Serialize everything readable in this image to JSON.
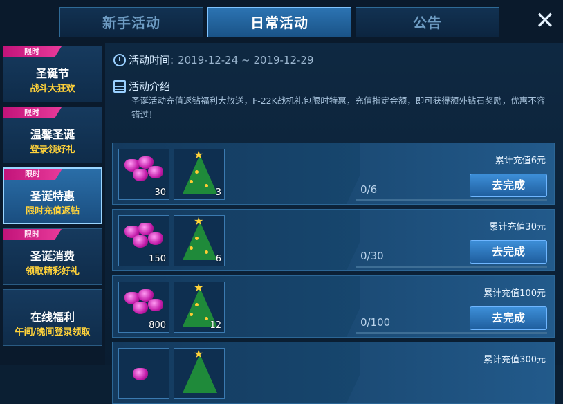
{
  "tabs": [
    {
      "label": "新手活动",
      "active": false
    },
    {
      "label": "日常活动",
      "active": true
    },
    {
      "label": "公告",
      "active": false
    }
  ],
  "close_label": "✕",
  "sidebar": {
    "items": [
      {
        "badge": "限时",
        "title": "圣诞节",
        "subtitle": "战斗大狂欢",
        "active": false
      },
      {
        "badge": "限时",
        "title": "温馨圣诞",
        "subtitle": "登录领好礼",
        "active": false
      },
      {
        "badge": "限时",
        "title": "圣诞特惠",
        "subtitle": "限时充值返钻",
        "active": true
      },
      {
        "badge": "限时",
        "title": "圣诞消费",
        "subtitle": "领取精彩好礼",
        "active": false
      },
      {
        "badge": "",
        "title": "在线福利",
        "subtitle": "午间/晚间登录领取",
        "active": false
      }
    ]
  },
  "activity": {
    "time_label": "活动时间:",
    "time_value": "2019-12-24 ~ 2019-12-29",
    "intro_label": "活动介绍",
    "intro_text": "圣诞活动充值返钻福利大放送，F-22K战机礼包限时特惠，充值指定金额，即可获得额外钻石奖励，优惠不容错过！"
  },
  "tasks": [
    {
      "requirement": "累计充值6元",
      "progress": "0/6",
      "button": "去完成",
      "rewards": [
        {
          "icon": "diamond-icon",
          "count": "30"
        },
        {
          "icon": "christmas-tree-icon",
          "count": "3"
        }
      ]
    },
    {
      "requirement": "累计充值30元",
      "progress": "0/30",
      "button": "去完成",
      "rewards": [
        {
          "icon": "diamond-icon",
          "count": "150"
        },
        {
          "icon": "christmas-tree-icon",
          "count": "6"
        }
      ]
    },
    {
      "requirement": "累计充值100元",
      "progress": "0/100",
      "button": "去完成",
      "rewards": [
        {
          "icon": "diamond-icon",
          "count": "800"
        },
        {
          "icon": "christmas-tree-icon",
          "count": "12"
        }
      ]
    },
    {
      "requirement": "累计充值300元",
      "progress": "",
      "button": "",
      "rewards": []
    }
  ],
  "colors": {
    "accent": "#2c74b3",
    "badge": "#d61f86",
    "highlight": "#ffd23a"
  }
}
